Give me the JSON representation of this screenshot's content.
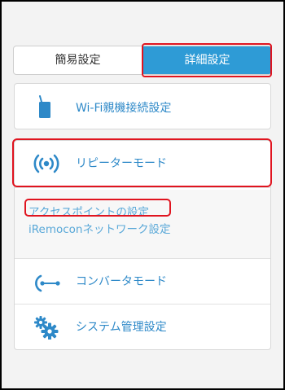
{
  "tabs": {
    "simple_label": "簡易設定",
    "detail_label": "詳細設定"
  },
  "menu": {
    "wifi_label": "Wi-Fi親機接続設定",
    "repeater_label": "リピーターモード",
    "access_point_label": "アクセスポイントの設定",
    "network_label": "iRemoconネットワーク設定",
    "converter_label": "コンバータモード",
    "system_label": "システム管理設定"
  },
  "colors": {
    "accent": "#2e9bd6",
    "link": "#59a8d8",
    "highlight": "#e0141f"
  },
  "icons": [
    "router-icon",
    "wireless-signal-icon",
    "converter-icon",
    "gear-icon"
  ]
}
